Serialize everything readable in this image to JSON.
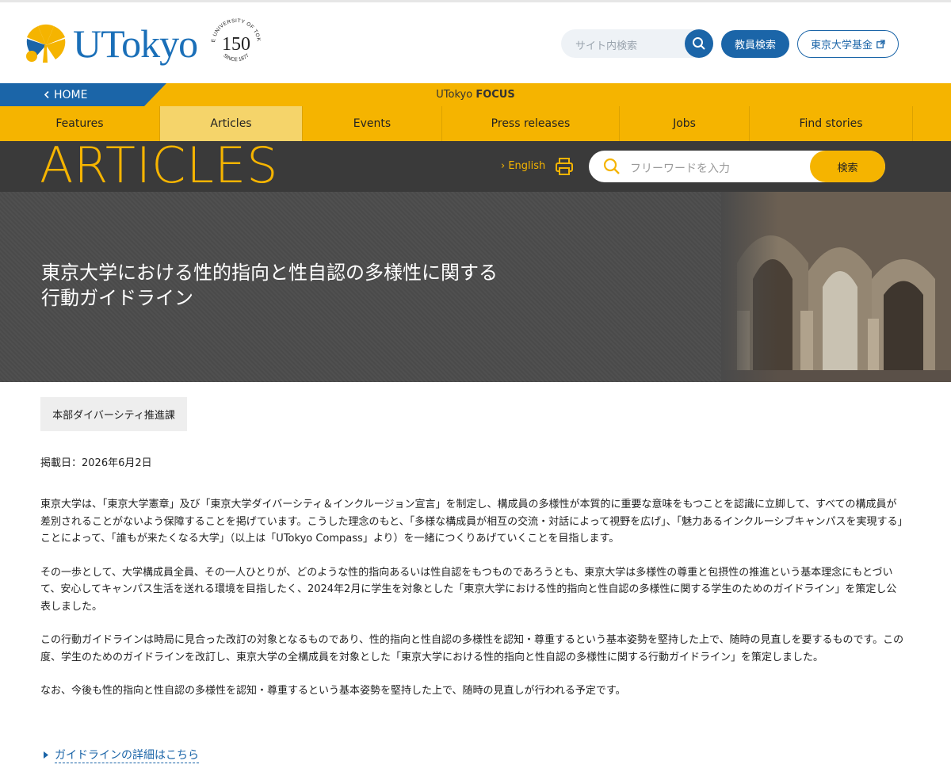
{
  "header": {
    "logo_text": "UTokyo",
    "seal_number": "150",
    "seal_top": "THE UNIVERSITY OF TOKYO",
    "seal_bottom": "SINCE 1877",
    "search_placeholder": "サイト内検索",
    "faculty_search_label": "教員検索",
    "fund_label": "東京大学基金"
  },
  "focus_bar": {
    "home_label": "HOME",
    "title_prefix": "UTokyo ",
    "title_strong": "FOCUS"
  },
  "nav": {
    "items": [
      {
        "label": "Features"
      },
      {
        "label": "Articles"
      },
      {
        "label": "Events"
      },
      {
        "label": "Press releases"
      },
      {
        "label": "Jobs"
      },
      {
        "label": "Find stories"
      }
    ],
    "active": "Articles"
  },
  "articles_band": {
    "title": "ARTICLES",
    "english_label": "English",
    "search_placeholder": "フリーワードを入力",
    "search_button": "検索"
  },
  "hero": {
    "title_line1": "東京大学における性的指向と性自認の多様性に関する",
    "title_line2": "行動ガイドライン"
  },
  "article": {
    "department": "本部ダイバーシティ推進課",
    "date": "掲載日：2026年6月2日",
    "paragraphs": [
      "東京大学は、「東京大学憲章」及び「東京大学ダイバーシティ＆インクルージョン宣言」を制定し、構成員の多様性が本質的に重要な意味をもつことを認識に立脚して、すべての構成員が差別されることがないよう保障することを掲げています。こうした理念のもと、「多様な構成員が相互の交流・対話によって視野を広げ」、「魅力あるインクルーシブキャンパスを実現する」ことによって、「誰もが来たくなる大学」（以上は「UTokyo Compass」より）を一緒につくりあげていくことを目指します。",
      "その一歩として、大学構成員全員、その一人ひとりが、どのような性的指向あるいは性自認をもつものであろうとも、東京大学は多様性の尊重と包摂性の推進という基本理念にもとづいて、安心してキャンパス生活を送れる環境を目指したく、2024年2月に学生を対象とした「東京大学における性的指向と性自認の多様性に関する学生のためのガイドライン」を策定し公表しました。",
      "この行動ガイドラインは時局に見合った改訂の対象となるものであり、性的指向と性自認の多様性を認知・尊重するという基本姿勢を堅持した上で、随時の見直しを要するものです。この度、学生のためのガイドラインを改訂し、東京大学の全構成員を対象とした「東京大学における性的指向と性自認の多様性に関する行動ガイドライン」を策定しました。",
      "なお、今後も性的指向と性自認の多様性を認知・尊重するという基本姿勢を堅持した上で、随時の見直しが行われる予定です。"
    ],
    "detail_link": "ガイドラインの詳細はこちら"
  },
  "colors": {
    "brand_blue": "#1b65a8",
    "brand_yellow": "#f5b400",
    "dark_band": "#3a3a3a"
  }
}
